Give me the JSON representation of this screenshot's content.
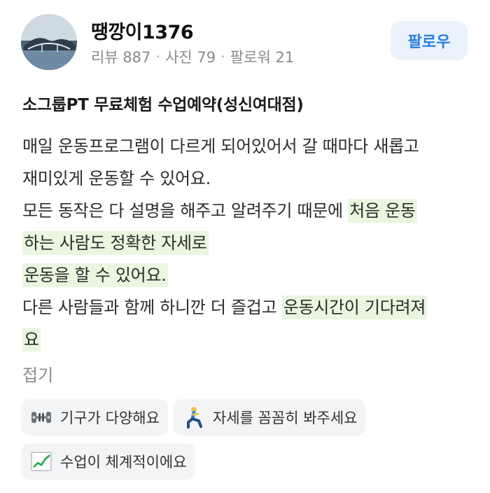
{
  "profile": {
    "username": "땡깡이1376",
    "reviews_label": "리뷰 887",
    "photos_label": "사진 79",
    "followers_label": "팔로워 21",
    "separator": "·",
    "follow_button": "팔로우"
  },
  "product_title": "소그룹PT 무료체험 수업예약(성신여대점)",
  "review_lines": [
    [
      {
        "text": "매일 운동프로그램이 다르게 되어있어서 갈 때마다 새롭고",
        "hl": false
      }
    ],
    [
      {
        "text": "재미있게 운동할 수 있어요.",
        "hl": false
      }
    ],
    [
      {
        "text": "모든 동작은 다 설명을 해주고 알려주기 때문에 ",
        "hl": false
      },
      {
        "text": "처음 운동",
        "hl": true
      }
    ],
    [
      {
        "text": "하는 사람도 정확한 자세로",
        "hl": true
      }
    ],
    [
      {
        "text": "운동을 할 수 있어요.",
        "hl": true
      }
    ],
    [
      {
        "text": "다른 사람들과 함께 하니깐 더 즐겁고 ",
        "hl": false
      },
      {
        "text": "운동시간이 기다려져",
        "hl": true
      }
    ],
    [
      {
        "text": "요",
        "hl": true
      }
    ]
  ],
  "fold_label": "접기",
  "tags": [
    [
      {
        "icon": "dumbbell-icon",
        "label": "기구가 다양해요"
      },
      {
        "icon": "lunge-person-icon",
        "label": "자세를 꼼꼼히 봐주세요"
      }
    ],
    [
      {
        "icon": "chart-increasing-icon",
        "label": "수업이 체계적이에요"
      }
    ]
  ],
  "colors": {
    "highlight": "#e9f6e0",
    "follow_bg": "#eaf3fc",
    "follow_text": "#2a7ee0",
    "tag_bg": "#f3f4f6",
    "muted_text": "#8a8a8a"
  }
}
